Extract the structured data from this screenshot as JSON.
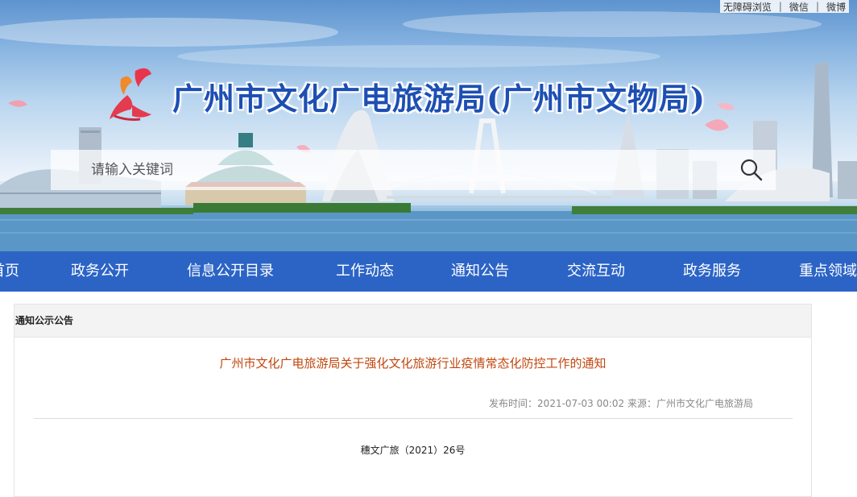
{
  "top_links": {
    "accessibility": "无障碍浏览",
    "wechat": "微信",
    "weibo": "微博"
  },
  "site_title": "广州市文化广电旅游局(广州市文物局)",
  "search": {
    "placeholder": "请输入关键词"
  },
  "nav": {
    "items": [
      "首页",
      "政务公开",
      "信息公开目录",
      "工作动态",
      "通知公告",
      "交流互动",
      "政务服务",
      "重点领域"
    ]
  },
  "panel": {
    "heading": "通知公示公告"
  },
  "article": {
    "title": "广州市文化广电旅游局关于强化文化旅游行业疫情常态化防控工作的通知",
    "meta": "发布时间：2021-07-03 00:02 来源：广州市文化广电旅游局",
    "doc_number": "穗文广旅（2021）26号"
  },
  "colors": {
    "nav_bg": "#2c64c6",
    "title_blue": "#1d4fb3",
    "article_title": "#c1470f"
  }
}
